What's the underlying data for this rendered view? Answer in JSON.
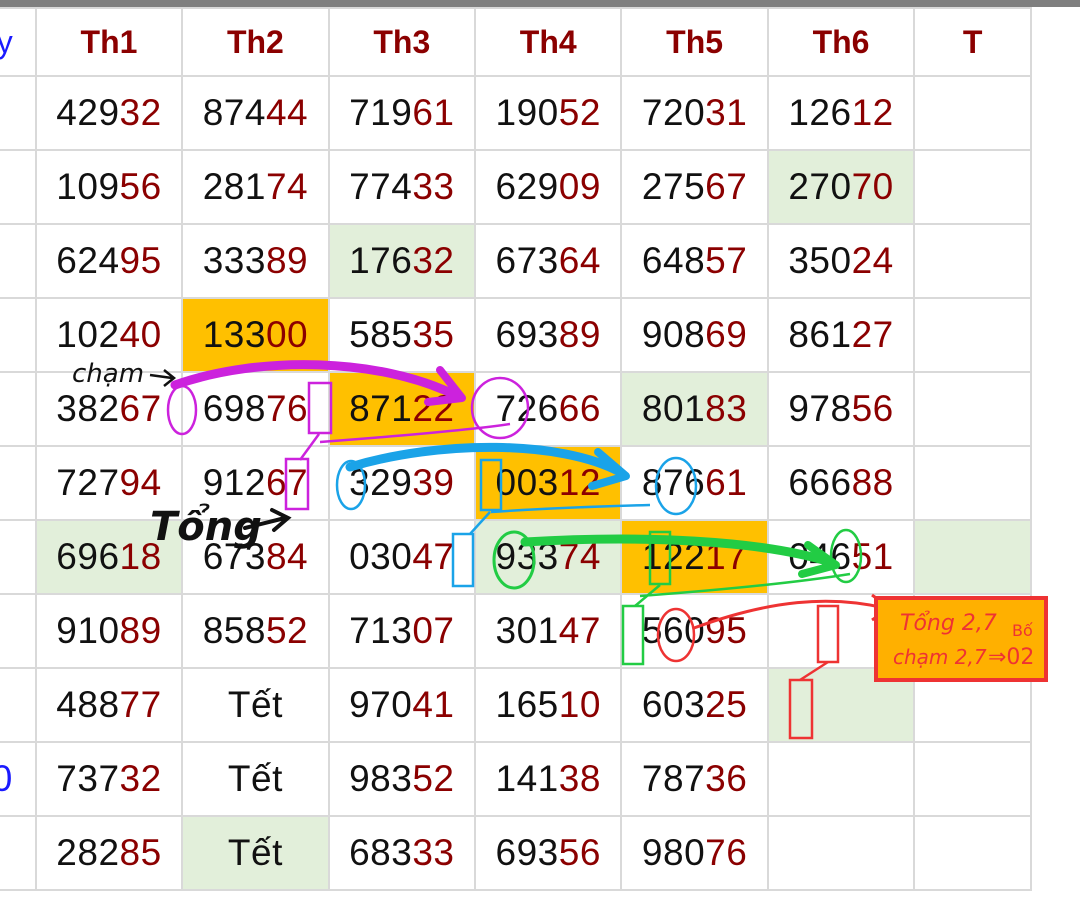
{
  "header": {
    "date_label": "ay",
    "days": [
      "Th1",
      "Th2",
      "Th3",
      "Th4",
      "Th5",
      "Th6",
      "T"
    ]
  },
  "rows": [
    {
      "label": "",
      "cells": [
        [
          "429",
          "32"
        ],
        [
          "874",
          "44"
        ],
        [
          "719",
          "61"
        ],
        [
          "190",
          "52"
        ],
        [
          "720",
          "31"
        ],
        [
          "126",
          "12"
        ],
        [
          "",
          ""
        ]
      ]
    },
    {
      "label": "",
      "cells": [
        [
          "109",
          "56"
        ],
        [
          "281",
          "74"
        ],
        [
          "774",
          "33"
        ],
        [
          "629",
          "09"
        ],
        [
          "275",
          "67"
        ],
        [
          "270",
          "70"
        ],
        [
          "",
          ""
        ]
      ]
    },
    {
      "label": "",
      "cells": [
        [
          "624",
          "95"
        ],
        [
          "333",
          "89"
        ],
        [
          "176",
          "32"
        ],
        [
          "673",
          "64"
        ],
        [
          "648",
          "57"
        ],
        [
          "350",
          "24"
        ],
        [
          "",
          ""
        ]
      ]
    },
    {
      "label": "",
      "cells": [
        [
          "102",
          "40"
        ],
        [
          "133",
          "00"
        ],
        [
          "585",
          "35"
        ],
        [
          "693",
          "89"
        ],
        [
          "908",
          "69"
        ],
        [
          "861",
          "27"
        ],
        [
          "",
          ""
        ]
      ]
    },
    {
      "label": "",
      "cells": [
        [
          "382",
          "67"
        ],
        [
          "698",
          "76"
        ],
        [
          "871",
          "22"
        ],
        [
          "726",
          "66"
        ],
        [
          "801",
          "83"
        ],
        [
          "978",
          "56"
        ],
        [
          "",
          ""
        ]
      ]
    },
    {
      "label": "",
      "cells": [
        [
          "727",
          "94"
        ],
        [
          "912",
          "67"
        ],
        [
          "329",
          "39"
        ],
        [
          "003",
          "12"
        ],
        [
          "876",
          "61"
        ],
        [
          "666",
          "88"
        ],
        [
          "",
          ""
        ]
      ]
    },
    {
      "label": "",
      "cells": [
        [
          "696",
          "18"
        ],
        [
          "673",
          "84"
        ],
        [
          "030",
          "47"
        ],
        [
          "933",
          "74"
        ],
        [
          "122",
          "17"
        ],
        [
          "046",
          "51"
        ],
        [
          "",
          ""
        ]
      ]
    },
    {
      "label": "",
      "cells": [
        [
          "910",
          "89"
        ],
        [
          "858",
          "52"
        ],
        [
          "713",
          "07"
        ],
        [
          "301",
          "47"
        ],
        [
          "560",
          "95"
        ],
        [
          "",
          ""
        ],
        [
          "",
          ""
        ]
      ]
    },
    {
      "label": "",
      "cells": [
        [
          "488",
          "77"
        ],
        [
          "Tết",
          ""
        ],
        [
          "970",
          "41"
        ],
        [
          "165",
          "10"
        ],
        [
          "603",
          "25"
        ],
        [
          "",
          ""
        ],
        [
          "",
          ""
        ]
      ]
    },
    {
      "label": "0",
      "cells": [
        [
          "737",
          "32"
        ],
        [
          "Tết",
          ""
        ],
        [
          "983",
          "52"
        ],
        [
          "141",
          "38"
        ],
        [
          "787",
          "36"
        ],
        [
          "",
          ""
        ],
        [
          "",
          ""
        ]
      ]
    },
    {
      "label": "",
      "cells": [
        [
          "282",
          "85"
        ],
        [
          "Tết",
          ""
        ],
        [
          "683",
          "33"
        ],
        [
          "693",
          "56"
        ],
        [
          "980",
          "76"
        ],
        [
          "",
          ""
        ],
        [
          "",
          ""
        ]
      ]
    }
  ],
  "highlights": {
    "green": [
      [
        1,
        5
      ],
      [
        2,
        2
      ],
      [
        4,
        4
      ],
      [
        6,
        0
      ],
      [
        6,
        3
      ],
      [
        6,
        6
      ],
      [
        8,
        5
      ],
      [
        10,
        1
      ]
    ],
    "orange": [
      [
        3,
        1
      ],
      [
        4,
        2
      ],
      [
        5,
        3
      ],
      [
        6,
        4
      ]
    ]
  },
  "annotations": {
    "cham": "chạm",
    "tong": "Tổng",
    "box_line1": "Tổng 2,7",
    "box_line2": "chạm 2,7",
    "box_side": "Bố",
    "box_result": "⇒02"
  },
  "colors": {
    "tail": "#8b0000",
    "header": "#8b0000",
    "green_cell": "#e2efda",
    "orange_cell": "#ffc000",
    "pen_magenta": "#cc22dd",
    "pen_blue": "#1aa3e8",
    "pen_green": "#22cc44",
    "pen_red": "#ee3333",
    "pen_black": "#111111"
  }
}
